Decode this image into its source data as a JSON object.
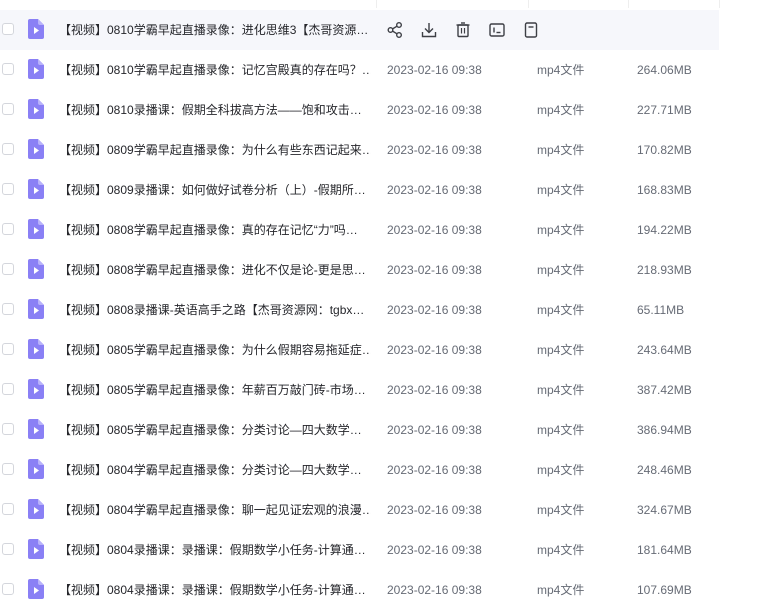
{
  "files": [
    {
      "name": "【视频】0810学霸早起直播录像：进化思维3【杰哥资源…",
      "date": "",
      "type": "",
      "size": ""
    },
    {
      "name": "【视频】0810学霸早起直播录像：记忆宫殿真的存在吗？…",
      "date": "2023-02-16 09:38",
      "type": "mp4文件",
      "size": "264.06MB"
    },
    {
      "name": "【视频】0810录播课：假期全科拔高方法——饱和攻击…",
      "date": "2023-02-16 09:38",
      "type": "mp4文件",
      "size": "227.71MB"
    },
    {
      "name": "【视频】0809学霸早起直播录像：为什么有些东西记起来…",
      "date": "2023-02-16 09:38",
      "type": "mp4文件",
      "size": "170.82MB"
    },
    {
      "name": "【视频】0809录播课：如何做好试卷分析（上）-假期所…",
      "date": "2023-02-16 09:38",
      "type": "mp4文件",
      "size": "168.83MB"
    },
    {
      "name": "【视频】0808学霸早起直播录像：真的存在记忆“力”吗…",
      "date": "2023-02-16 09:38",
      "type": "mp4文件",
      "size": "194.22MB"
    },
    {
      "name": "【视频】0808学霸早起直播录像：进化不仅是论-更是思…",
      "date": "2023-02-16 09:38",
      "type": "mp4文件",
      "size": "218.93MB"
    },
    {
      "name": "【视频】0808录播课-英语高手之路【杰哥资源网：tgbx…",
      "date": "2023-02-16 09:38",
      "type": "mp4文件",
      "size": "65.11MB"
    },
    {
      "name": "【视频】0805学霸早起直播录像：为什么假期容易拖延症…",
      "date": "2023-02-16 09:38",
      "type": "mp4文件",
      "size": "243.64MB"
    },
    {
      "name": "【视频】0805学霸早起直播录像：年薪百万敲门砖-市场…",
      "date": "2023-02-16 09:38",
      "type": "mp4文件",
      "size": "387.42MB"
    },
    {
      "name": "【视频】0805学霸早起直播录像：分类讨论—四大数学…",
      "date": "2023-02-16 09:38",
      "type": "mp4文件",
      "size": "386.94MB"
    },
    {
      "name": "【视频】0804学霸早起直播录像：分类讨论—四大数学…",
      "date": "2023-02-16 09:38",
      "type": "mp4文件",
      "size": "248.46MB"
    },
    {
      "name": "【视频】0804学霸早起直播录像：聊一起见证宏观的浪漫…",
      "date": "2023-02-16 09:38",
      "type": "mp4文件",
      "size": "324.67MB"
    },
    {
      "name": "【视频】0804录播课：录播课：假期数学小任务-计算通…",
      "date": "2023-02-16 09:38",
      "type": "mp4文件",
      "size": "181.64MB"
    },
    {
      "name": "【视频】0804录播课：录播课：假期数学小任务-计算通…",
      "date": "2023-02-16 09:38",
      "type": "mp4文件",
      "size": "107.69MB"
    }
  ],
  "hover_actions": [
    {
      "icon": "share-icon"
    },
    {
      "icon": "download-icon"
    },
    {
      "icon": "delete-icon"
    },
    {
      "icon": "rename-icon"
    },
    {
      "icon": "more-icon"
    }
  ],
  "colors": {
    "file_icon": "#8a80f5",
    "hover_row_bg": "#f6f7fb",
    "name_text": "#25262b",
    "meta_text": "#666b75"
  }
}
